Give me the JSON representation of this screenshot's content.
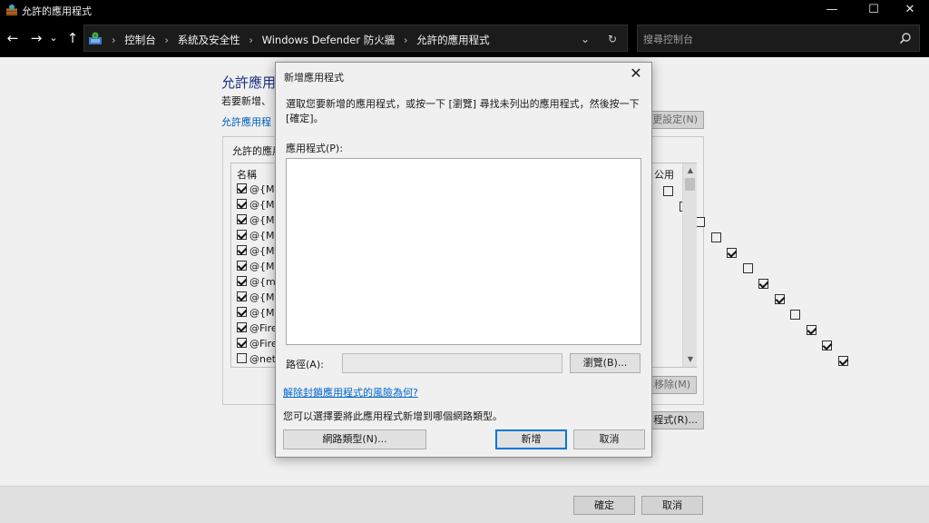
{
  "window": {
    "title": "允許的應用程式",
    "controls": {
      "minimize": "—",
      "maximize": "☐",
      "close": "✕"
    }
  },
  "addressbar": {
    "nav": {
      "back": "←",
      "forward": "→",
      "recent": "⌄",
      "up": "↑"
    },
    "breadcrumbs": [
      "控制台",
      "系統及安全性",
      "Windows Defender 防火牆",
      "允許的應用程式"
    ],
    "separator": "›",
    "dropdown": "⌄",
    "refresh": "↻",
    "search_placeholder": "搜尋控制台"
  },
  "background": {
    "heading": "允許應用",
    "description": "若要新增、",
    "link": "允許應用程",
    "change_settings_button": "更設定(N)",
    "group_label": "允許的應用",
    "list": {
      "name_header": "名稱",
      "public_header": "公用",
      "rows": [
        {
          "name": "@{Mi",
          "checked": true,
          "public": false
        },
        {
          "name": "@{Mi",
          "checked": true,
          "public": false
        },
        {
          "name": "@{Mi",
          "checked": true,
          "public": false
        },
        {
          "name": "@{Mi",
          "checked": true,
          "public": false
        },
        {
          "name": "@{Mi",
          "checked": true,
          "public": true
        },
        {
          "name": "@{Mi",
          "checked": true,
          "public": false
        },
        {
          "name": "@{mi",
          "checked": true,
          "public": true
        },
        {
          "name": "@{Mi",
          "checked": true,
          "public": true
        },
        {
          "name": "@{Mi",
          "checked": true,
          "public": false
        },
        {
          "name": "@Fire",
          "checked": true,
          "public": true
        },
        {
          "name": "@Fire",
          "checked": true,
          "public": true
        },
        {
          "name": "@net",
          "checked": false,
          "public": true
        }
      ]
    },
    "remove_button": "移除(M)",
    "allow_other_button": "程式(R)...",
    "footer": {
      "ok": "確定",
      "cancel": "取消"
    }
  },
  "dialog": {
    "title": "新增應用程式",
    "close": "✕",
    "description": "選取您要新增的應用程式，或按一下 [瀏覽] 尋找未列出的應用程式，然後按一下 [確定]。",
    "apps_label": "應用程式(P):",
    "path_label": "路徑(A):",
    "path_value": "",
    "browse_button": "瀏覽(B)...",
    "risk_link": "解除封鎖應用程式的風險為何?",
    "network_hint": "您可以選擇要將此應用程式新增到哪個網路類型。",
    "network_types_button": "網路類型(N)...",
    "add_button": "新增",
    "cancel_button": "取消"
  }
}
